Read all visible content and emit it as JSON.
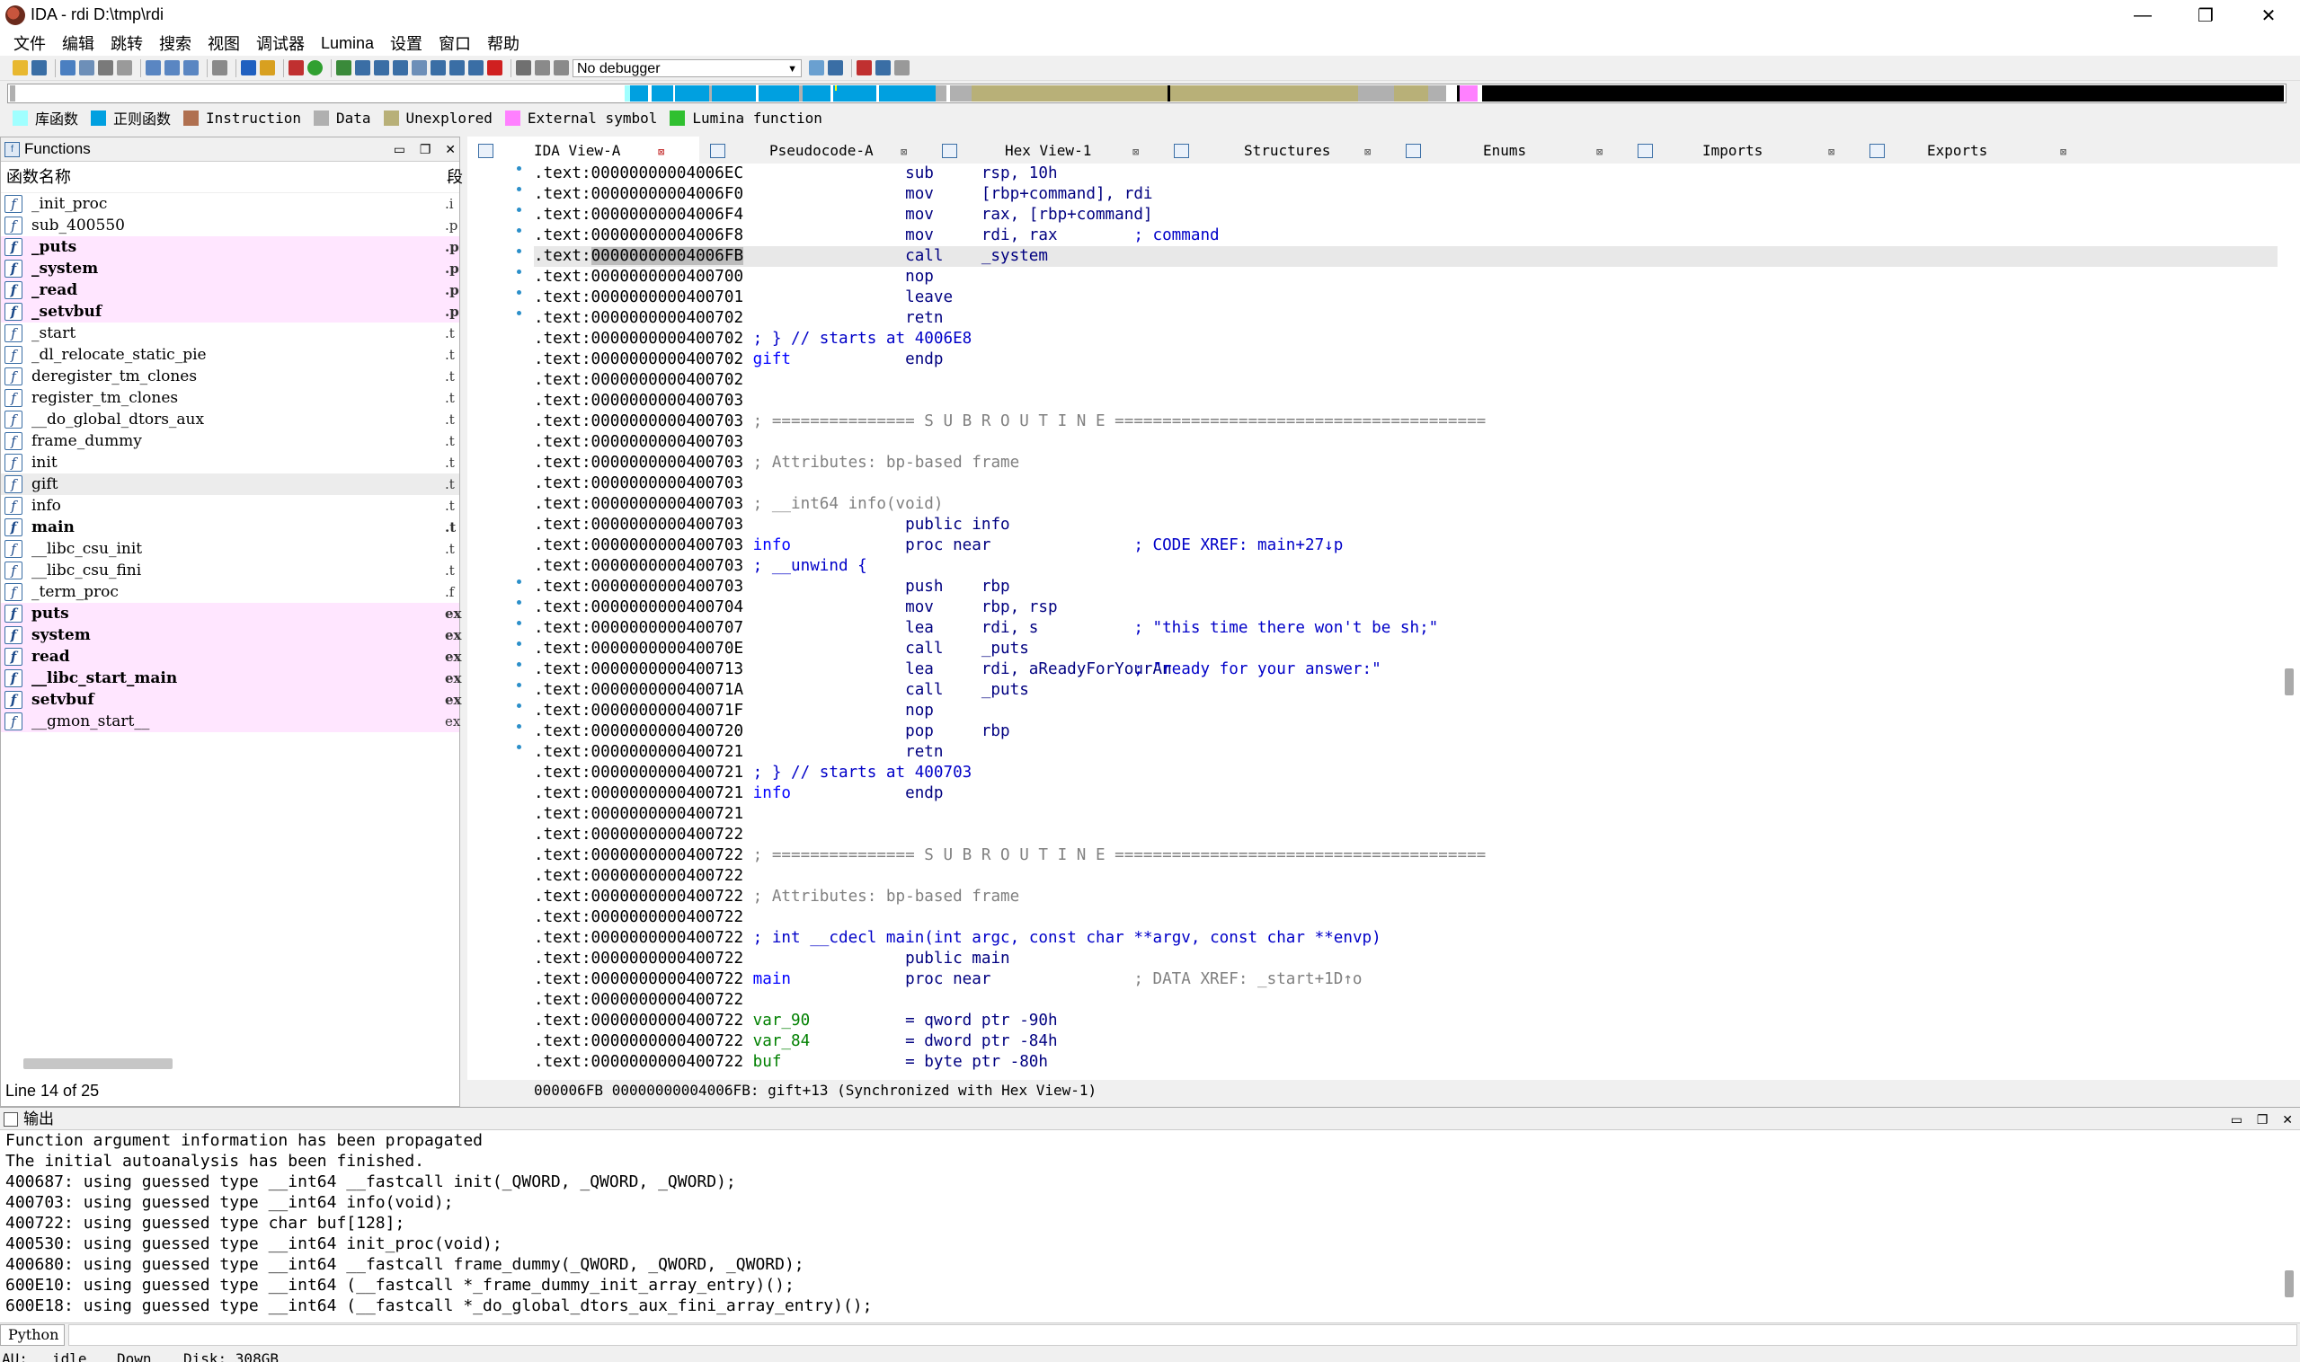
{
  "window": {
    "title": "IDA - rdi D:\\tmp\\rdi",
    "controls": {
      "minimize": "—",
      "maximize": "❐",
      "close": "✕"
    }
  },
  "menu": [
    "文件",
    "编辑",
    "跳转",
    "搜索",
    "视图",
    "调试器",
    "Lumina",
    "设置",
    "窗口",
    "帮助"
  ],
  "toolbar": {
    "debugger": "No debugger"
  },
  "legend": [
    {
      "label": "库函数",
      "color": "#a0ffff"
    },
    {
      "label": "正则函数",
      "color": "#00a0e0"
    },
    {
      "label": "Instruction",
      "color": "#b07050"
    },
    {
      "label": "Data",
      "color": "#b0b0b0"
    },
    {
      "label": "Unexplored",
      "color": "#b8b078"
    },
    {
      "label": "External symbol",
      "color": "#ff80ff"
    },
    {
      "label": "Lumina function",
      "color": "#30c030"
    }
  ],
  "functions": {
    "title": "Functions",
    "col_name": "函数名称",
    "col_seg": "段",
    "items": [
      {
        "name": "_init_proc",
        "seg": ".i",
        "style": ""
      },
      {
        "name": "sub_400550",
        "seg": ".p",
        "style": ""
      },
      {
        "name": "_puts",
        "seg": ".p",
        "style": "pink bold"
      },
      {
        "name": "_system",
        "seg": ".p",
        "style": "pink bold"
      },
      {
        "name": "_read",
        "seg": ".p",
        "style": "pink bold"
      },
      {
        "name": "_setvbuf",
        "seg": ".p",
        "style": "pink bold"
      },
      {
        "name": "_start",
        "seg": ".t",
        "style": ""
      },
      {
        "name": "_dl_relocate_static_pie",
        "seg": ".t",
        "style": ""
      },
      {
        "name": "deregister_tm_clones",
        "seg": ".t",
        "style": ""
      },
      {
        "name": "register_tm_clones",
        "seg": ".t",
        "style": ""
      },
      {
        "name": "__do_global_dtors_aux",
        "seg": ".t",
        "style": ""
      },
      {
        "name": "frame_dummy",
        "seg": ".t",
        "style": ""
      },
      {
        "name": "init",
        "seg": ".t",
        "style": ""
      },
      {
        "name": "gift",
        "seg": ".t",
        "style": "sel"
      },
      {
        "name": "info",
        "seg": ".t",
        "style": ""
      },
      {
        "name": "main",
        "seg": ".t",
        "style": "bold"
      },
      {
        "name": "__libc_csu_init",
        "seg": ".t",
        "style": ""
      },
      {
        "name": "__libc_csu_fini",
        "seg": ".t",
        "style": ""
      },
      {
        "name": "_term_proc",
        "seg": ".f",
        "style": ""
      },
      {
        "name": "puts",
        "seg": "ex",
        "style": "pink bold"
      },
      {
        "name": "system",
        "seg": "ex",
        "style": "pink bold"
      },
      {
        "name": "read",
        "seg": "ex",
        "style": "pink bold"
      },
      {
        "name": "__libc_start_main",
        "seg": "ex",
        "style": "pink bold"
      },
      {
        "name": "setvbuf",
        "seg": "ex",
        "style": "pink bold"
      },
      {
        "name": "__gmon_start__",
        "seg": "ex",
        "style": "pink"
      }
    ],
    "status": "Line 14 of 25"
  },
  "tabs": [
    {
      "label": "IDA View-A",
      "close": "⊠",
      "active": true
    },
    {
      "label": "Pseudocode-A",
      "close": "⊠",
      "active": false
    },
    {
      "label": "Hex View-1",
      "close": "⊠",
      "active": false
    },
    {
      "label": "Structures",
      "close": "⊠",
      "active": false
    },
    {
      "label": "Enums",
      "close": "⊠",
      "active": false
    },
    {
      "label": "Imports",
      "close": "⊠",
      "active": false
    },
    {
      "label": "Exports",
      "close": "⊠",
      "active": false
    }
  ],
  "disasm": [
    {
      "addr": ".text:00000000004006EC",
      "dot": true,
      "mn": "sub",
      "op": "rsp, 10h"
    },
    {
      "addr": ".text:00000000004006F0",
      "dot": true,
      "mn": "mov",
      "op": "[rbp+command], rdi"
    },
    {
      "addr": ".text:00000000004006F4",
      "dot": true,
      "mn": "mov",
      "op": "rax, [rbp+command]"
    },
    {
      "addr": ".text:00000000004006F8",
      "dot": true,
      "mn": "mov",
      "op": "rdi, rax",
      "cm": "; command"
    },
    {
      "addr": ".text:00000000004006FB",
      "dot": true,
      "mn": "call",
      "op": "_system",
      "hl": true
    },
    {
      "addr": ".text:0000000000400700",
      "dot": true,
      "mn": "nop"
    },
    {
      "addr": ".text:0000000000400701",
      "dot": true,
      "mn": "leave"
    },
    {
      "addr": ".text:0000000000400702",
      "dot": true,
      "mn": "retn"
    },
    {
      "addr": ".text:0000000000400702",
      "raw": "; } // starts at 4006E8",
      "rawcls": "c-cm"
    },
    {
      "addr": ".text:0000000000400702",
      "label": "gift",
      "mn": "endp"
    },
    {
      "addr": ".text:0000000000400702"
    },
    {
      "addr": ".text:0000000000400703"
    },
    {
      "addr": ".text:0000000000400703",
      "raw": "; =============== S U B R O U T I N E =======================================",
      "rawcls": "c-gray"
    },
    {
      "addr": ".text:0000000000400703"
    },
    {
      "addr": ".text:0000000000400703",
      "raw": "; Attributes: bp-based frame",
      "rawcls": "c-gray"
    },
    {
      "addr": ".text:0000000000400703"
    },
    {
      "addr": ".text:0000000000400703",
      "raw": "; __int64 info(void)",
      "rawcls": "c-gray"
    },
    {
      "addr": ".text:0000000000400703",
      "mn": "public info"
    },
    {
      "addr": ".text:0000000000400703",
      "label": "info",
      "mn": "proc near",
      "cm": "; CODE XREF: main+27↓p"
    },
    {
      "addr": ".text:0000000000400703",
      "raw": "; __unwind {",
      "rawcls": "c-cm"
    },
    {
      "addr": ".text:0000000000400703",
      "dot": true,
      "mn": "push",
      "op": "rbp"
    },
    {
      "addr": ".text:0000000000400704",
      "dot": true,
      "mn": "mov",
      "op": "rbp, rsp"
    },
    {
      "addr": ".text:0000000000400707",
      "dot": true,
      "mn": "lea",
      "op": "rdi, s",
      "cm": "; \"this time there won't be sh;\""
    },
    {
      "addr": ".text:000000000040070E",
      "dot": true,
      "mn": "call",
      "op": "_puts"
    },
    {
      "addr": ".text:0000000000400713",
      "dot": true,
      "mn": "lea",
      "op": "rdi, aReadyForYourAn",
      "cm": "; \"ready for your answer:\""
    },
    {
      "addr": ".text:000000000040071A",
      "dot": true,
      "mn": "call",
      "op": "_puts"
    },
    {
      "addr": ".text:000000000040071F",
      "dot": true,
      "mn": "nop"
    },
    {
      "addr": ".text:0000000000400720",
      "dot": true,
      "mn": "pop",
      "op": "rbp"
    },
    {
      "addr": ".text:0000000000400721",
      "dot": true,
      "mn": "retn"
    },
    {
      "addr": ".text:0000000000400721",
      "raw": "; } // starts at 400703",
      "rawcls": "c-cm"
    },
    {
      "addr": ".text:0000000000400721",
      "label": "info",
      "mn": "endp"
    },
    {
      "addr": ".text:0000000000400721"
    },
    {
      "addr": ".text:0000000000400722"
    },
    {
      "addr": ".text:0000000000400722",
      "raw": "; =============== S U B R O U T I N E =======================================",
      "rawcls": "c-gray"
    },
    {
      "addr": ".text:0000000000400722"
    },
    {
      "addr": ".text:0000000000400722",
      "raw": "; Attributes: bp-based frame",
      "rawcls": "c-gray"
    },
    {
      "addr": ".text:0000000000400722"
    },
    {
      "addr": ".text:0000000000400722",
      "raw": "; int __cdecl main(int argc, const char **argv, const char **envp)",
      "rawcls": "c-name"
    },
    {
      "addr": ".text:0000000000400722",
      "mn": "public main"
    },
    {
      "addr": ".text:0000000000400722",
      "label": "main",
      "mn": "proc near",
      "cm": "; DATA XREF: _start+1D↑o",
      "cmcls": "c-gray"
    },
    {
      "addr": ".text:0000000000400722"
    },
    {
      "addr": ".text:0000000000400722",
      "var": "var_90",
      "mn": "= qword ptr -90h"
    },
    {
      "addr": ".text:0000000000400722",
      "var": "var_84",
      "mn": "= dword ptr -84h"
    },
    {
      "addr": ".text:0000000000400722",
      "var": "buf",
      "mn": "= byte ptr -80h"
    }
  ],
  "disasm_status": "000006FB 00000000004006FB: gift+13 (Synchronized with Hex View-1)",
  "output": {
    "title": "输出",
    "lines": [
      "Function argument information has been propagated",
      "The initial autoanalysis has been finished.",
      "400687: using guessed type __int64 __fastcall init(_QWORD, _QWORD, _QWORD);",
      "400703: using guessed type __int64 info(void);",
      "400722: using guessed type char buf[128];",
      "400530: using guessed type __int64 init_proc(void);",
      "400680: using guessed type __int64 __fastcall frame_dummy(_QWORD, _QWORD, _QWORD);",
      "600E10: using guessed type __int64 (__fastcall *_frame_dummy_init_array_entry)();",
      "600E18: using guessed type __int64 (__fastcall *_do_global_dtors_aux_fini_array_entry)();"
    ]
  },
  "python": {
    "label": "Python"
  },
  "status": {
    "au": "AU:",
    "state": "idle",
    "dir": "Down",
    "disk": "Disk: 308GB"
  }
}
